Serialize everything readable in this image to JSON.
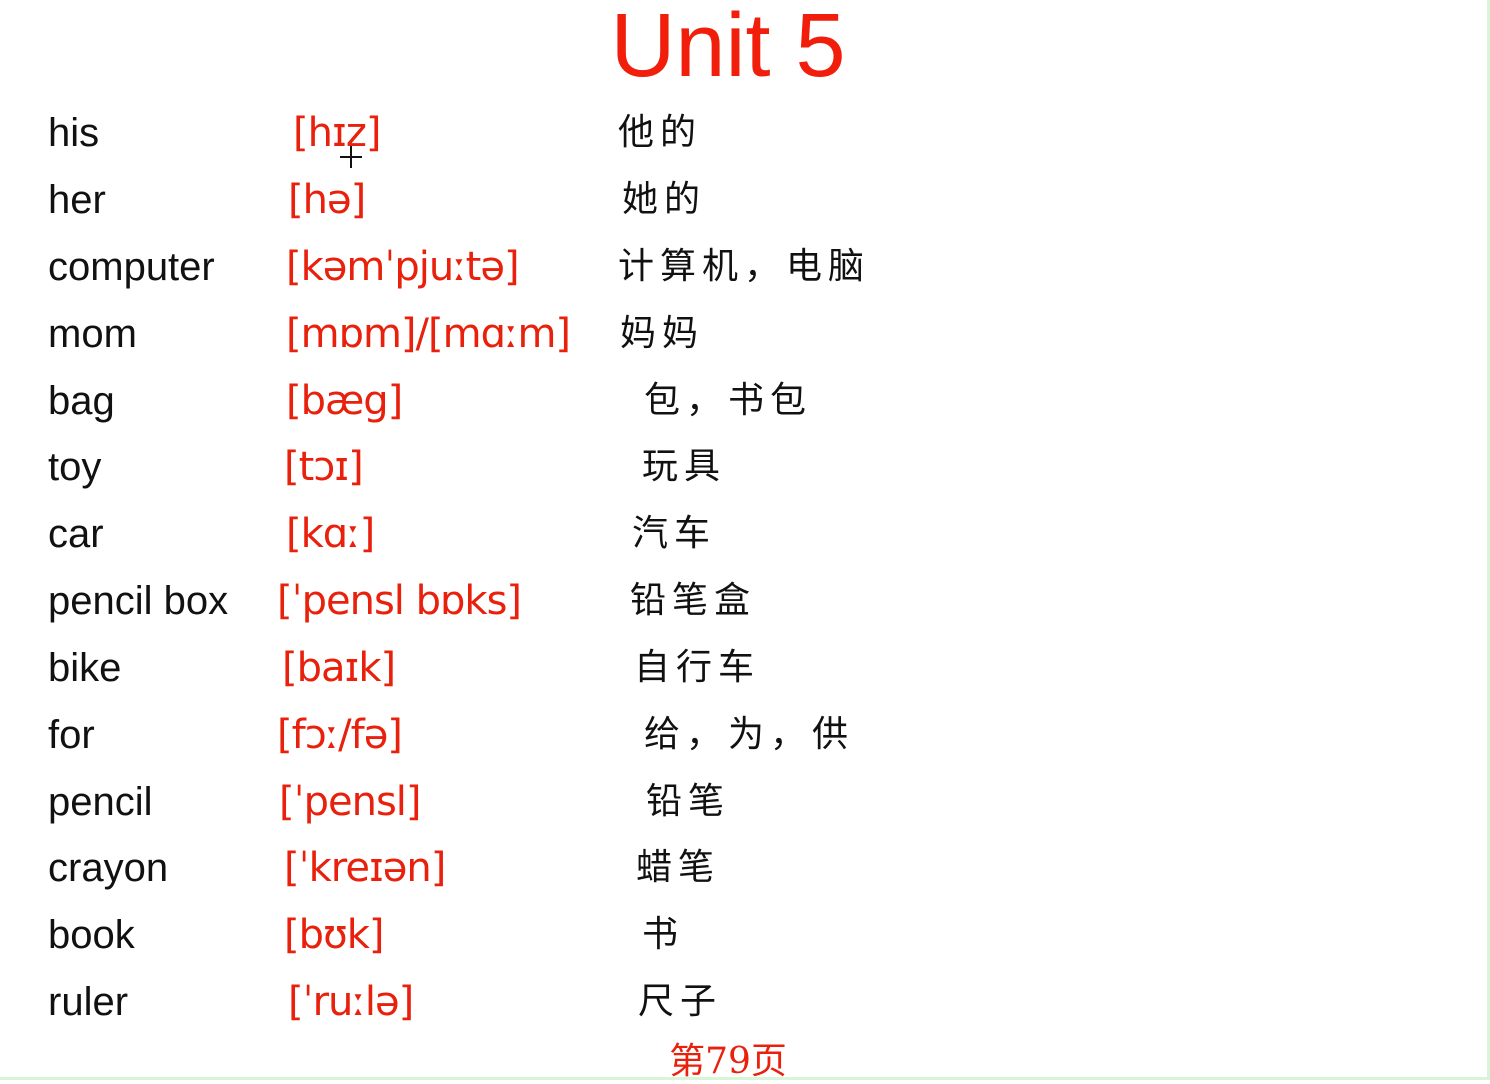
{
  "title": "Unit 5",
  "page_label": "第79页",
  "colors": {
    "accent": "#f01e0a",
    "text": "#111111",
    "border": "#d8f5d8"
  },
  "rows": [
    {
      "word": "his",
      "phonetic": "[hɪz]",
      "meaning": "他的"
    },
    {
      "word": "her",
      "phonetic": "[hə]",
      "meaning": "她的"
    },
    {
      "word": "computer",
      "phonetic": "[kəmˈpjuːtə]",
      "meaning": "计算机，电脑"
    },
    {
      "word": "mom",
      "phonetic": "[mɒm]/[mɑːm]",
      "meaning": "妈妈"
    },
    {
      "word": "bag",
      "phonetic": "[bæg]",
      "meaning": "包，书包"
    },
    {
      "word": "toy",
      "phonetic": "[tɔɪ]",
      "meaning": "玩具"
    },
    {
      "word": "car",
      "phonetic": "[kɑː]",
      "meaning": "汽车"
    },
    {
      "word": "pencil box",
      "phonetic": "[ˈpensl bɒks]",
      "meaning": "铅笔盒"
    },
    {
      "word": "bike",
      "phonetic": "[baɪk]",
      "meaning": "自行车"
    },
    {
      "word": "for",
      "phonetic": "[fɔː/fə]",
      "meaning": "给，为，供"
    },
    {
      "word": "pencil",
      "phonetic": "[ˈpensl]",
      "meaning": "铅笔"
    },
    {
      "word": "crayon",
      "phonetic": "[ˈkreɪən]",
      "meaning": "蜡笔"
    },
    {
      "word": "book",
      "phonetic": "[bʊk]",
      "meaning": "书"
    },
    {
      "word": "ruler",
      "phonetic": "[ˈruːlə]",
      "meaning": "尺子"
    }
  ]
}
